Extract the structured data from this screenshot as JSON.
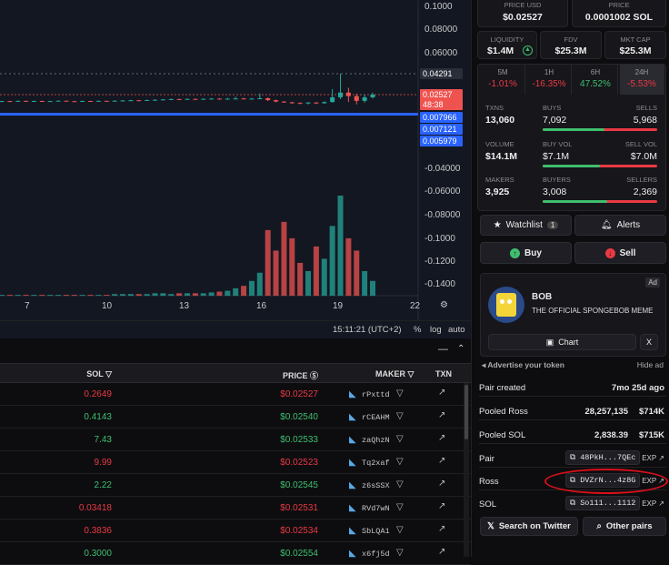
{
  "chart": {
    "y_ticks": [
      "0.1000",
      "0.08000",
      "0.06000",
      "0.04291",
      "0.02527",
      "48:38",
      "0.007966",
      "0.007121",
      "0.005979",
      "-0.04000",
      "-0.06000",
      "-0.08000",
      "-0.1000",
      "-0.1200",
      "-0.1400"
    ],
    "x_ticks": [
      "7",
      "10",
      "13",
      "16",
      "19",
      "22"
    ],
    "time": "15:11:21 (UTC+2)",
    "opts": [
      "%",
      "log",
      "auto"
    ],
    "colors": {
      "up": "#26a69a",
      "down": "#ef5350",
      "line": "#2962ff",
      "bg": "#131722"
    },
    "candles": [
      {
        "o": 0.0195,
        "c": 0.0198,
        "h": 0.0201,
        "l": 0.0192
      },
      {
        "o": 0.0198,
        "c": 0.0196,
        "h": 0.02,
        "l": 0.0193
      },
      {
        "o": 0.0196,
        "c": 0.02,
        "h": 0.0203,
        "l": 0.0194
      },
      {
        "o": 0.02,
        "c": 0.0197,
        "h": 0.0202,
        "l": 0.0194
      },
      {
        "o": 0.0197,
        "c": 0.0199,
        "h": 0.0203,
        "l": 0.0195
      },
      {
        "o": 0.0199,
        "c": 0.0195,
        "h": 0.0201,
        "l": 0.0192
      },
      {
        "o": 0.0195,
        "c": 0.0198,
        "h": 0.02,
        "l": 0.0193
      },
      {
        "o": 0.0198,
        "c": 0.0201,
        "h": 0.0204,
        "l": 0.0196
      },
      {
        "o": 0.0201,
        "c": 0.0197,
        "h": 0.0203,
        "l": 0.0195
      },
      {
        "o": 0.0197,
        "c": 0.0196,
        "h": 0.02,
        "l": 0.0193
      },
      {
        "o": 0.0196,
        "c": 0.0199,
        "h": 0.0202,
        "l": 0.0194
      },
      {
        "o": 0.0199,
        "c": 0.0197,
        "h": 0.0201,
        "l": 0.0194
      },
      {
        "o": 0.0197,
        "c": 0.02,
        "h": 0.0203,
        "l": 0.0195
      },
      {
        "o": 0.02,
        "c": 0.0198,
        "h": 0.0202,
        "l": 0.0196
      },
      {
        "o": 0.0198,
        "c": 0.0201,
        "h": 0.0205,
        "l": 0.0196
      },
      {
        "o": 0.0201,
        "c": 0.0203,
        "h": 0.0207,
        "l": 0.0199
      },
      {
        "o": 0.0203,
        "c": 0.0205,
        "h": 0.0209,
        "l": 0.0201
      },
      {
        "o": 0.0205,
        "c": 0.0204,
        "h": 0.0208,
        "l": 0.0201
      },
      {
        "o": 0.0204,
        "c": 0.0207,
        "h": 0.0211,
        "l": 0.0202
      },
      {
        "o": 0.0207,
        "c": 0.0209,
        "h": 0.0214,
        "l": 0.0205
      },
      {
        "o": 0.0209,
        "c": 0.0212,
        "h": 0.0216,
        "l": 0.0207
      },
      {
        "o": 0.0212,
        "c": 0.0215,
        "h": 0.022,
        "l": 0.021
      },
      {
        "o": 0.0215,
        "c": 0.0213,
        "h": 0.0219,
        "l": 0.021
      },
      {
        "o": 0.0213,
        "c": 0.0216,
        "h": 0.0221,
        "l": 0.0211
      },
      {
        "o": 0.0216,
        "c": 0.0214,
        "h": 0.022,
        "l": 0.0211
      },
      {
        "o": 0.0214,
        "c": 0.0217,
        "h": 0.0222,
        "l": 0.0212
      },
      {
        "o": 0.0217,
        "c": 0.0219,
        "h": 0.0224,
        "l": 0.0214
      },
      {
        "o": 0.0219,
        "c": 0.0216,
        "h": 0.0223,
        "l": 0.0213
      },
      {
        "o": 0.0216,
        "c": 0.0218,
        "h": 0.0226,
        "l": 0.0213
      },
      {
        "o": 0.0218,
        "c": 0.022,
        "h": 0.0235,
        "l": 0.0215
      },
      {
        "o": 0.022,
        "c": 0.0217,
        "h": 0.0226,
        "l": 0.0213
      },
      {
        "o": 0.0217,
        "c": 0.0219,
        "h": 0.0224,
        "l": 0.0214
      },
      {
        "o": 0.0219,
        "c": 0.0222,
        "h": 0.0262,
        "l": 0.0216
      },
      {
        "o": 0.0222,
        "c": 0.0206,
        "h": 0.023,
        "l": 0.02
      },
      {
        "o": 0.0206,
        "c": 0.0194,
        "h": 0.021,
        "l": 0.0188
      },
      {
        "o": 0.0194,
        "c": 0.0188,
        "h": 0.0198,
        "l": 0.0183
      },
      {
        "o": 0.0188,
        "c": 0.0183,
        "h": 0.0192,
        "l": 0.0176
      },
      {
        "o": 0.0183,
        "c": 0.0178,
        "h": 0.0188,
        "l": 0.0172
      },
      {
        "o": 0.0178,
        "c": 0.0186,
        "h": 0.019,
        "l": 0.017
      },
      {
        "o": 0.0186,
        "c": 0.018,
        "h": 0.019,
        "l": 0.0174
      },
      {
        "o": 0.018,
        "c": 0.019,
        "h": 0.0196,
        "l": 0.0176
      },
      {
        "o": 0.019,
        "c": 0.023,
        "h": 0.03,
        "l": 0.0185
      },
      {
        "o": 0.023,
        "c": 0.027,
        "h": 0.0429,
        "l": 0.0215
      },
      {
        "o": 0.027,
        "c": 0.024,
        "h": 0.031,
        "l": 0.019
      },
      {
        "o": 0.024,
        "c": 0.02,
        "h": 0.026,
        "l": 0.017
      },
      {
        "o": 0.02,
        "c": 0.023,
        "h": 0.025,
        "l": 0.0185
      },
      {
        "o": 0.023,
        "c": 0.0253,
        "h": 0.027,
        "l": 0.022
      }
    ],
    "volumes": [
      1,
      1,
      1,
      1,
      1,
      1,
      1,
      1,
      1,
      1,
      1,
      1,
      1,
      1,
      2,
      2,
      2,
      2,
      2,
      3,
      3,
      2,
      3,
      3,
      3,
      3,
      4,
      5,
      6,
      9,
      12,
      18,
      28,
      80,
      55,
      90,
      70,
      40,
      30,
      60,
      45,
      85,
      122,
      70,
      55,
      30,
      18
    ]
  },
  "table": {
    "headers": {
      "sol": "SOL",
      "price": "PRICE",
      "maker": "MAKER",
      "txn": "TXN"
    },
    "rows": [
      {
        "sol": "0.2649",
        "price": "$0.02527",
        "maker": "rPxttd",
        "side": "sell"
      },
      {
        "sol": "0.4143",
        "price": "$0.02540",
        "maker": "rCEAHM",
        "side": "buy"
      },
      {
        "sol": "7.43",
        "price": "$0.02533",
        "maker": "zaQhzN",
        "side": "buy"
      },
      {
        "sol": "9.99",
        "price": "$0.02523",
        "maker": "Tq2xaf",
        "side": "sell"
      },
      {
        "sol": "2.22",
        "price": "$0.02545",
        "maker": "z6sSSX",
        "side": "buy"
      },
      {
        "sol": "0.03418",
        "price": "$0.02531",
        "maker": "RVd7wN",
        "side": "sell"
      },
      {
        "sol": "0.3836",
        "price": "$0.02534",
        "maker": "SbLQA1",
        "side": "sell"
      },
      {
        "sol": "0.3000",
        "price": "$0.02554",
        "maker": "x6fj5d",
        "side": "buy"
      }
    ]
  },
  "panel": {
    "price_usd": {
      "label": "PRICE USD",
      "value": "$0.02527"
    },
    "price_sol": {
      "label": "PRICE",
      "value": "0.0001002 SOL"
    },
    "liquidity": {
      "label": "LIQUIDITY",
      "value": "$1.4M"
    },
    "fdv": {
      "label": "FDV",
      "value": "$25.3M"
    },
    "mkt_cap": {
      "label": "MKT CAP",
      "value": "$25.3M"
    },
    "timeframes": [
      {
        "k": "5M",
        "v": "-1.01%",
        "dir": "down"
      },
      {
        "k": "1H",
        "v": "-16.35%",
        "dir": "down"
      },
      {
        "k": "6H",
        "v": "47.52%",
        "dir": "up"
      },
      {
        "k": "24H",
        "v": "-5.53%",
        "dir": "down"
      }
    ],
    "txns": {
      "label": "TXNS",
      "value": "13,060",
      "buys_label": "BUYS",
      "buys": "7,092",
      "sells_label": "SELLS",
      "sells": "5,968",
      "buy_frac": 0.54
    },
    "volume": {
      "label": "VOLUME",
      "value": "$14.1M",
      "buy_label": "BUY VOL",
      "buy": "$7.1M",
      "sell_label": "SELL VOL",
      "sell": "$7.0M",
      "buy_frac": 0.5
    },
    "makers": {
      "label": "MAKERS",
      "value": "3,925",
      "buyers_label": "BUYERS",
      "buyers": "3,008",
      "sellers_label": "SELLERS",
      "sellers": "2,369",
      "buy_frac": 0.56
    },
    "watchlist": "Watchlist",
    "watch_count": "1",
    "alerts": "Alerts",
    "buy": "Buy",
    "sell": "Sell",
    "ad": {
      "tag": "Ad",
      "name": "BOB",
      "desc": "THE OFFICIAL SPONGEBOB MEME",
      "chart": "Chart",
      "close": "X",
      "advertise": "Advertise your token",
      "hide": "Hide ad"
    },
    "pair_created": {
      "label": "Pair created",
      "value": "7mo 25d ago"
    },
    "pooled_ross": {
      "label": "Pooled Ross",
      "amount": "28,257,135",
      "usd": "$714K"
    },
    "pooled_sol": {
      "label": "Pooled SOL",
      "amount": "2,838.39",
      "usd": "$715K"
    },
    "pair": {
      "label": "Pair",
      "addr": "48PkH...7QEc",
      "exp": "EXP"
    },
    "ross": {
      "label": "Ross",
      "addr": "DVZrN...4z8G",
      "exp": "EXP"
    },
    "sol": {
      "label": "SOL",
      "addr": "So111...1112",
      "exp": "EXP"
    },
    "search_twitter": "Search on Twitter",
    "other_pairs": "Other pairs"
  }
}
